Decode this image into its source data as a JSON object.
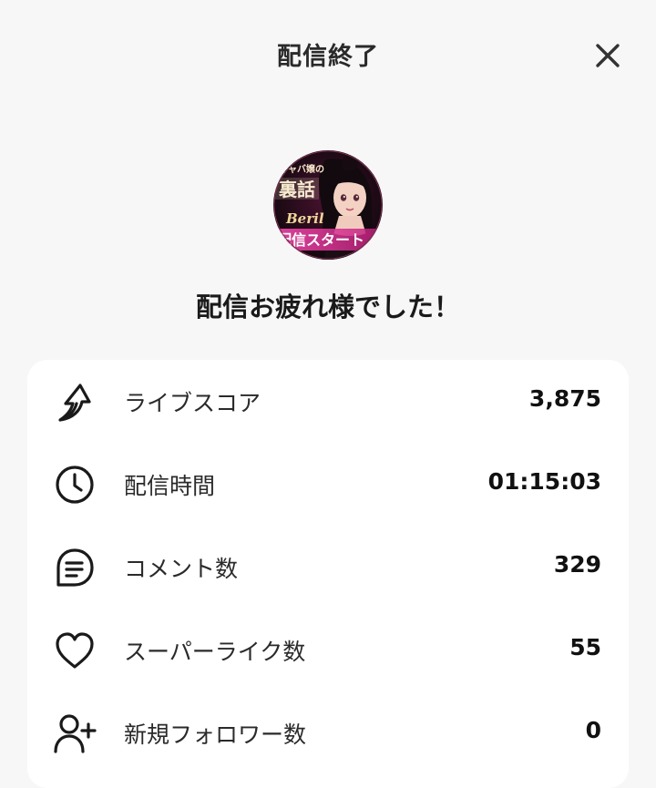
{
  "header": {
    "title": "配信終了",
    "close_icon": "close-icon"
  },
  "profile": {
    "avatar_icon": "stream-thumbnail-avatar",
    "avatar_lettering": [
      "キャバ嬢の",
      "裏話",
      "Beril",
      "配信スタート"
    ]
  },
  "message": "配信お疲れ様でした！",
  "stats": [
    {
      "icon": "live-score-arrow-icon",
      "label": "ライブスコア",
      "value": "3,875"
    },
    {
      "icon": "clock-icon",
      "label": "配信時間",
      "value": "01:15:03"
    },
    {
      "icon": "comment-icon",
      "label": "コメント数",
      "value": "329"
    },
    {
      "icon": "heart-icon",
      "label": "スーパーライク数",
      "value": "55"
    },
    {
      "icon": "add-follower-icon",
      "label": "新規フォロワー数",
      "value": "0"
    }
  ],
  "colors": {
    "background": "#f7f7f7",
    "card": "#ffffff",
    "text": "#1a1a1a",
    "avatar_accent": "#d4388a"
  }
}
